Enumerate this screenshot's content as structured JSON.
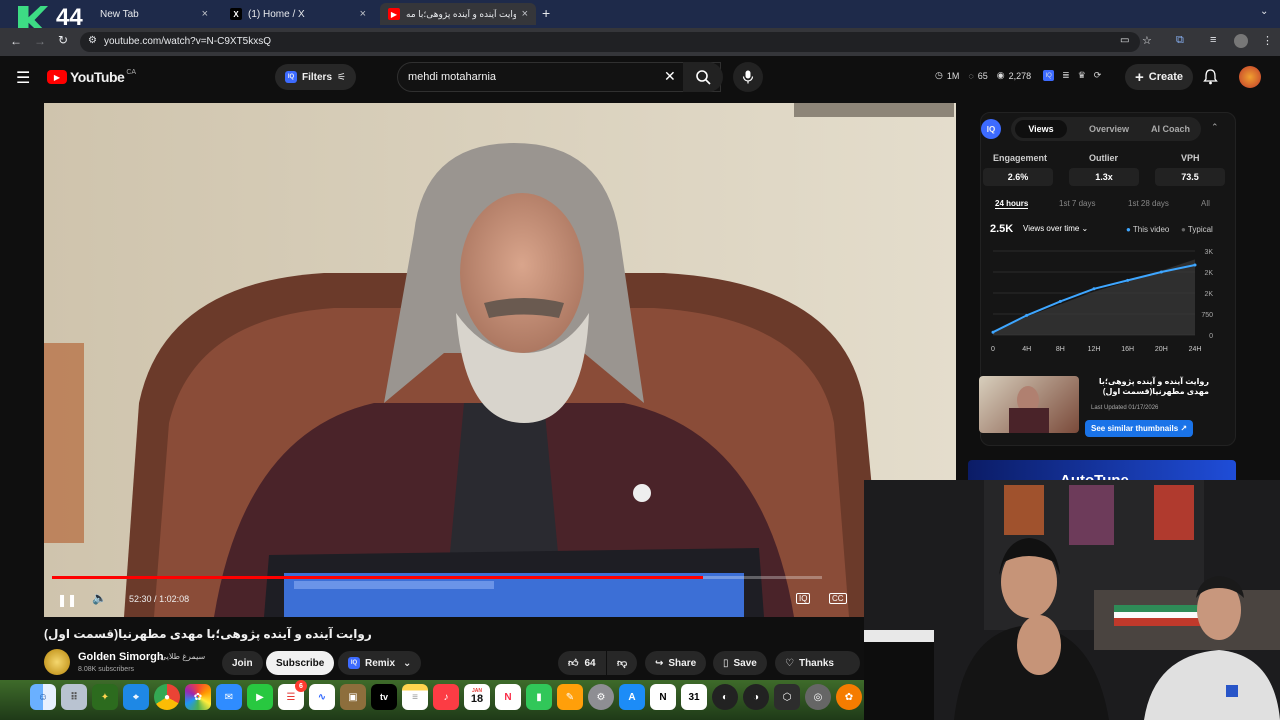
{
  "browser": {
    "tabs": [
      {
        "label": "New Tab",
        "close": "×"
      },
      {
        "label": "(1) Home / X",
        "close": "×"
      },
      {
        "label": "روایت آینده و آینده پژوهی؛با مه",
        "close": "×"
      }
    ],
    "new_tab": "+",
    "overlay_badge": "44",
    "url": "youtube.com/watch?v=N-C9XT5kxsQ"
  },
  "youtube": {
    "logo_text": "YouTube",
    "region": "CA",
    "filters_label": "Filters",
    "search_value": "mehdi motaharnia",
    "stats": {
      "views": "1M",
      "likes": "65",
      "subs": "2,278"
    },
    "create_label": "Create"
  },
  "player": {
    "time_current": "52:30",
    "time_sep": "/",
    "time_total": "1:02:08",
    "progress": 0.845
  },
  "video": {
    "title": "روایت آینده و آینده پژوهی؛با مهدی مطهرنیا(قسمت اول)",
    "channel_name": "Golden Simorgh",
    "channel_name_fa": "سیمرغ طلایی",
    "subscribers": "8.08K subscribers",
    "join_label": "Join",
    "subscribe_label": "Subscribe",
    "remix_label": "Remix",
    "likes": "64",
    "share_label": "Share",
    "save_label": "Save",
    "thanks_label": "Thanks"
  },
  "panel": {
    "logo": "IQ",
    "tabs": [
      "Views",
      "Overview",
      "AI Coach"
    ],
    "metrics": [
      {
        "label": "Engagement",
        "value": "2.6%"
      },
      {
        "label": "Outlier",
        "value": "1.3x"
      },
      {
        "label": "VPH",
        "value": "73.5"
      }
    ],
    "ranges": [
      "24 hours",
      "1st 7 days",
      "1st 28 days",
      "All"
    ],
    "total": "2.5K",
    "views_dropdown": "Views over time",
    "legend": [
      "This video",
      "Typical"
    ],
    "thumb_title": "روایت آینده و آینده پژوهی؛با مهدی مطهرنیا(قسمت اول)",
    "last_updated": "Last Updated 01/17/2026",
    "similar_btn": "See similar thumbnails ↗",
    "banner": "AutoTune"
  },
  "chart_data": {
    "type": "line",
    "x": [
      "0",
      "4H",
      "8H",
      "12H",
      "16H",
      "20H",
      "24H"
    ],
    "y_ticks": [
      "0",
      "750",
      "2K",
      "2K",
      "3K"
    ],
    "series": [
      {
        "name": "This video",
        "values": [
          100,
          700,
          1200,
          1650,
          1950,
          2250,
          2500
        ]
      },
      {
        "name": "Typical",
        "values": [
          100,
          650,
          1100,
          1550,
          1900,
          2300,
          2700
        ]
      }
    ],
    "ylim": [
      0,
      3000
    ]
  },
  "dock": {
    "calendar_month": "JAN",
    "calendar_day": "18",
    "tv_label": "tv",
    "badge": "6"
  },
  "colors": {
    "accent": "#3ea6ff",
    "youtube_red": "#ff0000",
    "panel_bg": "#151515"
  }
}
